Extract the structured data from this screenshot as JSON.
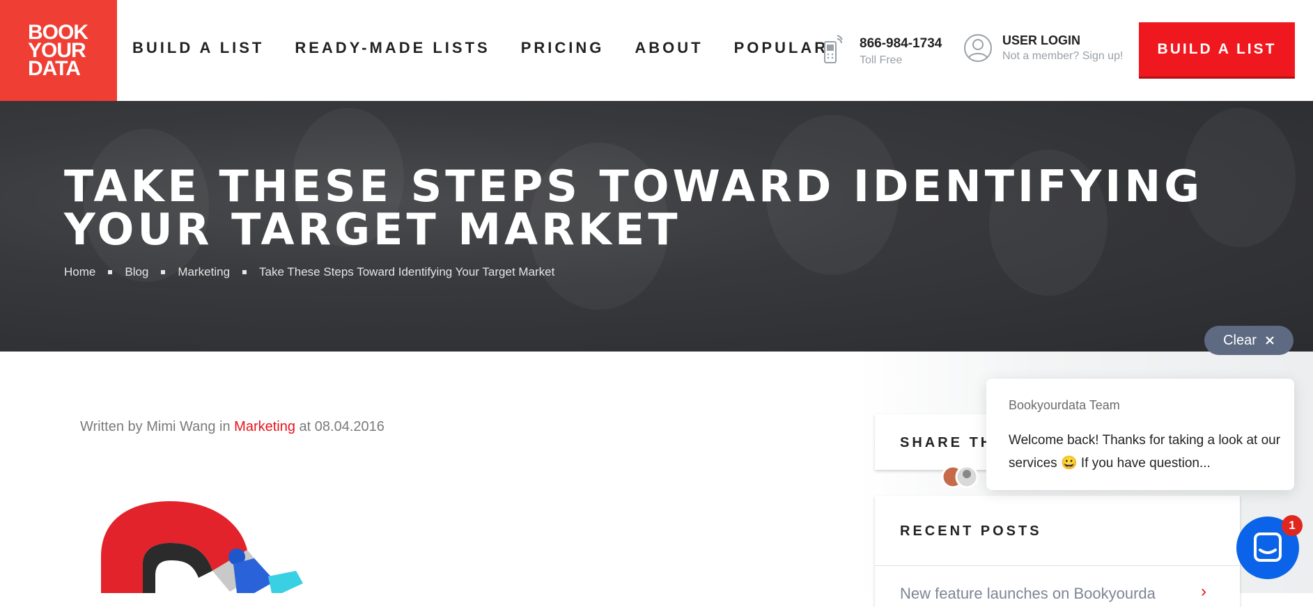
{
  "logo": {
    "lines": [
      "BOOK",
      "YOUR",
      "DATA"
    ]
  },
  "nav": {
    "items": [
      {
        "label": "BUILD A LIST"
      },
      {
        "label": "READY-MADE LISTS"
      },
      {
        "label": "PRICING"
      },
      {
        "label": "ABOUT"
      },
      {
        "label": "POPULAR"
      }
    ]
  },
  "contact": {
    "phone": "866-984-1734",
    "phone_sub": "Toll Free"
  },
  "login": {
    "title": "USER LOGIN",
    "sub": "Not a member? Sign up!"
  },
  "cta": {
    "label": "BUILD A LIST"
  },
  "hero": {
    "title": "TAKE THESE STEPS TOWARD IDENTIFYING YOUR TARGET MARKET",
    "breadcrumb": [
      "Home",
      "Blog",
      "Marketing",
      "Take These Steps Toward Identifying Your Target Market"
    ]
  },
  "clear": {
    "label": "Clear",
    "icon": "close-icon"
  },
  "post": {
    "meta_prefix": "Written by Mimi Wang in",
    "category": "Marketing",
    "meta_suffix": "at 08.04.2016"
  },
  "sidebar": {
    "share_title": "SHARE THI",
    "recent_title": "RECENT POSTS",
    "recent_first": "New feature launches on Bookyourda"
  },
  "chat": {
    "sender": "Bookyourdata Team",
    "message": "Welcome back! Thanks for taking a look at our services 😀 If you have question...",
    "badge_count": "1"
  },
  "colors": {
    "brand_red": "#ef3e33",
    "cta_red": "#f0181f",
    "chat_blue": "#0a63e8",
    "clear_pill": "#5d6a82"
  }
}
